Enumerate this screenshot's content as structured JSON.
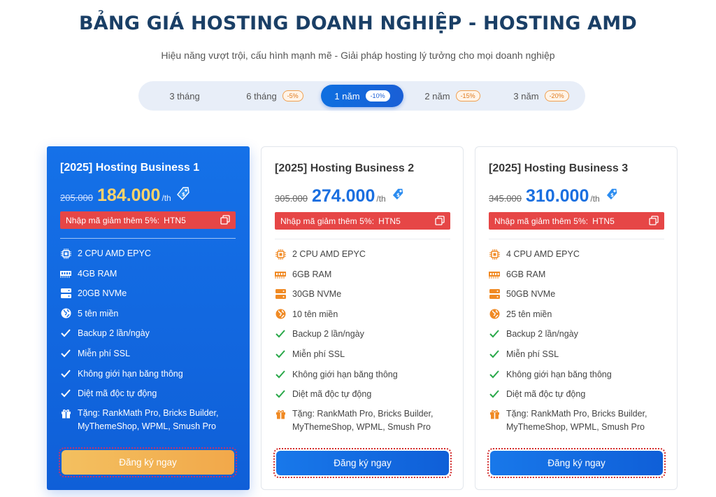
{
  "header": {
    "title": "BẢNG GIÁ HOSTING DOANH NGHIỆP - HOSTING AMD",
    "subtitle": "Hiệu năng vượt trội, cấu hình mạnh mẽ - Giải pháp hosting lý tưởng cho mọi doanh nghiệp"
  },
  "tabs": [
    {
      "label": "3 tháng",
      "badge": ""
    },
    {
      "label": "6 tháng",
      "badge": "-5%"
    },
    {
      "label": "1 năm",
      "badge": "-10%"
    },
    {
      "label": "2 năm",
      "badge": "-15%"
    },
    {
      "label": "3 năm",
      "badge": "-20%"
    }
  ],
  "active_tab": "1 năm",
  "colors": {
    "title": "#1a3f66",
    "primary_blue": "#1571e8",
    "price_blue": "#1a6fe0",
    "featured_price": "#ffd36a",
    "coupon_red": "#e64646",
    "featured_button": "#f2a84a",
    "icon_orange": "#f08a24",
    "check_green": "#2aa84a"
  },
  "plans": [
    {
      "name": "[2025] Hosting Business 1",
      "old_price": "205.000",
      "price": "184.000",
      "per": "/th",
      "coupon_label": "Nhập mã giảm thêm 5%:",
      "coupon_code": "HTN5",
      "features": [
        "2 CPU AMD EPYC",
        "4GB RAM",
        "20GB NVMe",
        "5 tên miền",
        "Backup 2 lần/ngày",
        "Miễn phí SSL",
        "Không giới hạn băng thông",
        "Diệt mã độc tự động"
      ],
      "gift_line1": "Tặng: RankMath Pro, Bricks Builder,",
      "gift_line2": "MyThemeShop, WPML, Smush Pro",
      "cta": "Đăng ký ngay"
    },
    {
      "name": "[2025] Hosting Business 2",
      "old_price": "305.000",
      "price": "274.000",
      "per": "/th",
      "coupon_label": "Nhập mã giảm thêm 5%:",
      "coupon_code": "HTN5",
      "features": [
        "2 CPU AMD EPYC",
        "6GB RAM",
        "30GB NVMe",
        "10 tên miền",
        "Backup 2 lần/ngày",
        "Miễn phí SSL",
        "Không giới hạn băng thông",
        "Diệt mã độc tự động"
      ],
      "gift_line1": "Tặng: RankMath Pro, Bricks Builder,",
      "gift_line2": "MyThemeShop, WPML, Smush Pro",
      "cta": "Đăng ký ngay"
    },
    {
      "name": "[2025] Hosting Business 3",
      "old_price": "345.000",
      "price": "310.000",
      "per": "/th",
      "coupon_label": "Nhập mã giảm thêm 5%:",
      "coupon_code": "HTN5",
      "features": [
        "4 CPU AMD EPYC",
        "6GB RAM",
        "50GB NVMe",
        "25 tên miền",
        "Backup 2 lần/ngày",
        "Miễn phí SSL",
        "Không giới hạn băng thông",
        "Diệt mã độc tự động"
      ],
      "gift_line1": "Tặng: RankMath Pro, Bricks Builder,",
      "gift_line2": "MyThemeShop, WPML, Smush Pro",
      "cta": "Đăng ký ngay"
    }
  ]
}
